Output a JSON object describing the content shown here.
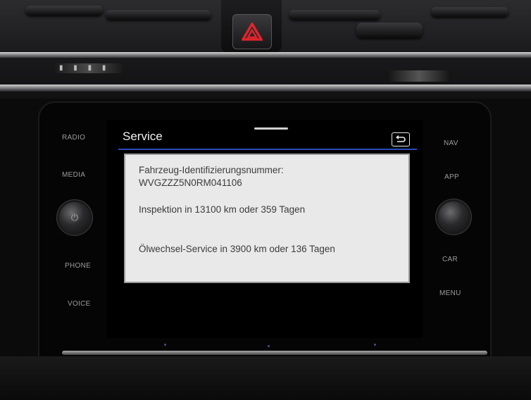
{
  "screen": {
    "title": "Service",
    "info": {
      "vin_label": "Fahrzeug-Identifizierungsnummer:",
      "vin_value": "WVGZZZ5N0RM041106",
      "inspection": "Inspektion in 13100 km oder 359 Tagen",
      "oil_service": "Ölwechsel-Service in 3900 km oder 136 Tagen"
    }
  },
  "left_buttons": {
    "radio": "RADIO",
    "media": "MEDIA",
    "phone": "PHONE",
    "voice": "VOICE"
  },
  "right_buttons": {
    "nav": "NAV",
    "app": "APP",
    "car": "CAR",
    "menu": "MENU"
  },
  "icons": {
    "hazard": "hazard-warning-icon",
    "back": "back-arrow-icon",
    "power": "power-icon"
  },
  "colors": {
    "title_underline": "#2a4bb8",
    "hazard_red": "#e0242c"
  }
}
